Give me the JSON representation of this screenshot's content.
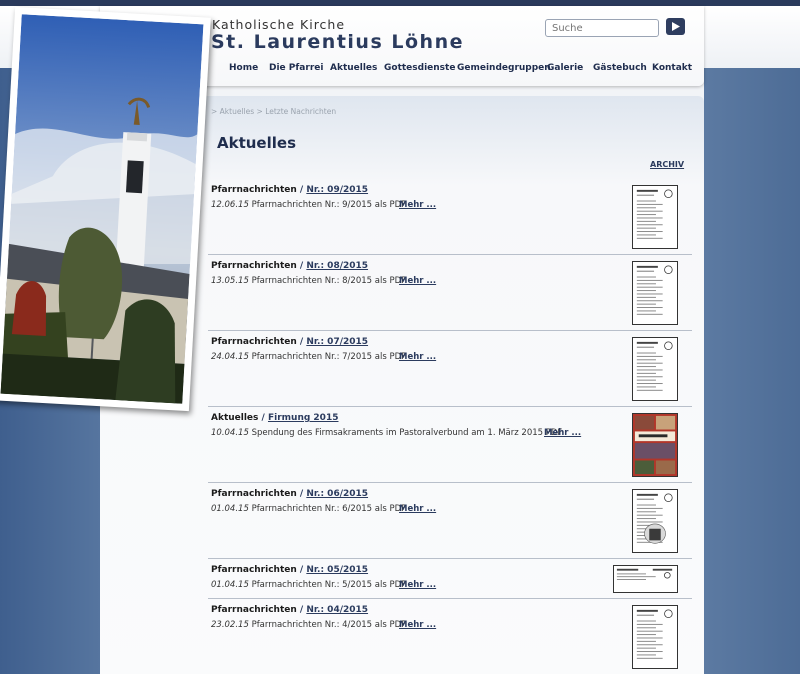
{
  "header": {
    "subtitle": "Katholische Kirche",
    "title": "St. Laurentius Löhne",
    "search_placeholder": "Suche"
  },
  "nav": [
    "Home",
    "Die Pfarrei",
    "Aktuelles",
    "Gottesdienste",
    "Gemeindegruppen",
    "Galerie",
    "Gästebuch",
    "Kontakt"
  ],
  "breadcrumb": "> Aktuelles > Letzte Nachrichten",
  "page_title": "Aktuelles",
  "archiv_label": "ARCHIV",
  "more_label": "Mehr ...",
  "news": [
    {
      "category": "Pfarrnachrichten",
      "separator": "/",
      "title": "Nr.: 09/2015",
      "date": "12.06.15",
      "text": "Pfarrnachrichten Nr.: 9/2015 als PDF",
      "thumb": "document"
    },
    {
      "category": "Pfarrnachrichten",
      "separator": "/",
      "title": "Nr.: 08/2015",
      "date": "13.05.15",
      "text": "Pfarrnachrichten Nr.: 8/2015 als PDF",
      "thumb": "document"
    },
    {
      "category": "Pfarrnachrichten",
      "separator": "/",
      "title": "Nr.: 07/2015",
      "date": "24.04.15",
      "text": "Pfarrnachrichten Nr.: 7/2015 als PDF",
      "thumb": "document"
    },
    {
      "category": "Aktuelles",
      "separator": "/",
      "title": "Firmung 2015",
      "date": "10.04.15",
      "text": "Spendung des Firmsakraments im Pastoralverbund am 1. März 2015 PDF",
      "thumb": "photo-collage"
    },
    {
      "category": "Pfarrnachrichten",
      "separator": "/",
      "title": "Nr.: 06/2015",
      "date": "01.04.15",
      "text": "Pfarrnachrichten Nr.: 6/2015 als PDF",
      "thumb": "document-image"
    },
    {
      "category": "Pfarrnachrichten",
      "separator": "/",
      "title": "Nr.: 05/2015",
      "date": "01.04.15",
      "text": "Pfarrnachrichten Nr.: 5/2015 als PDF",
      "thumb": "document-landscape"
    },
    {
      "category": "Pfarrnachrichten",
      "separator": "/",
      "title": "Nr.: 04/2015",
      "date": "23.02.15",
      "text": "Pfarrnachrichten Nr.: 4/2015 als PDF",
      "thumb": "document"
    }
  ],
  "colors": {
    "navy": "#1f2d4e",
    "link": "#2b3b5e",
    "background_blue": "#4d6c96"
  },
  "icons": {
    "search_button": "play-arrow-icon"
  }
}
